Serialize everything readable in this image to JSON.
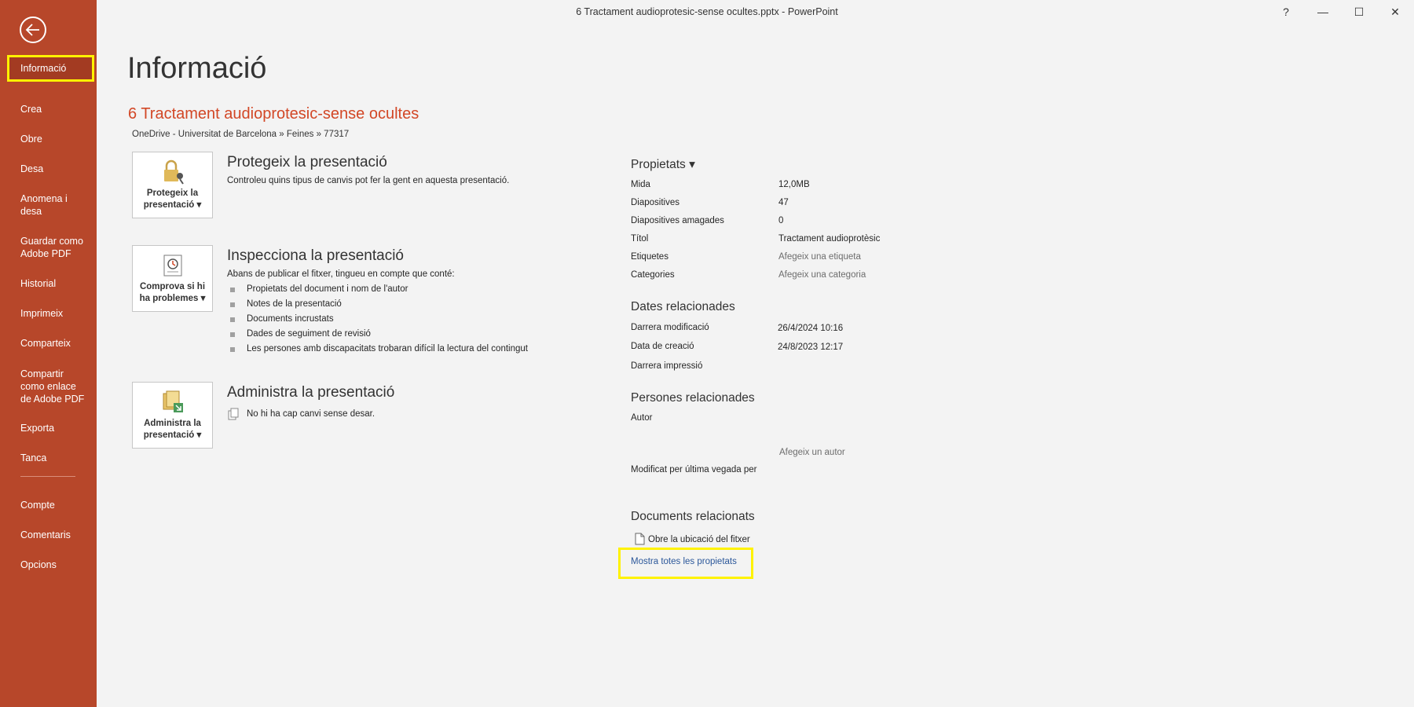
{
  "window": {
    "title": "6 Tractament audioprotesic-sense ocultes.pptx  -  PowerPoint",
    "help": "?",
    "minimize": "—",
    "maximize": "☐",
    "close": "✕"
  },
  "sidebar": {
    "items": [
      "Informació",
      "Crea",
      "Obre",
      "Desa",
      "Anomena i desa",
      "Guardar como Adobe PDF",
      "Historial",
      "Imprimeix",
      "Comparteix",
      "Compartir como enlace de Adobe PDF",
      "Exporta",
      "Tanca",
      "Compte",
      "Comentaris",
      "Opcions"
    ],
    "active": "Informació"
  },
  "main": {
    "page_title": "Informació",
    "doc_title": "6 Tractament audioprotesic-sense ocultes",
    "doc_path": "OneDrive - Universitat de Barcelona » Feines » 77317",
    "protect": {
      "card_label_1": "Protegeix la",
      "card_label_2": "presentació ▾",
      "title": "Protegeix la presentació",
      "desc": "Controleu quins tipus de canvis pot fer la gent en aquesta presentació."
    },
    "inspect": {
      "card_label_1": "Comprova si hi",
      "card_label_2": "ha problemes ▾",
      "title": "Inspecciona la presentació",
      "desc": "Abans de publicar el fitxer, tingueu en compte que conté:",
      "bullets": [
        "Propietats del document i nom de l'autor",
        "Notes de la presentació",
        "Documents incrustats",
        "Dades de seguiment de revisió",
        "Les persones amb discapacitats trobaran difícil la lectura del contingut"
      ]
    },
    "manage": {
      "card_label_1": "Administra la",
      "card_label_2": "presentació ▾",
      "title": "Administra la presentació",
      "desc": "No hi ha cap canvi sense desar."
    }
  },
  "properties": {
    "heading": "Propietats ▾",
    "rows": [
      {
        "label": "Mida",
        "value": "12,0MB"
      },
      {
        "label": "Diapositives",
        "value": "47"
      },
      {
        "label": "Diapositives amagades",
        "value": "0"
      },
      {
        "label": "Títol",
        "value": "Tractament audioprotèsic"
      },
      {
        "label": "Etiquetes",
        "value": "Afegeix una etiqueta"
      },
      {
        "label": "Categories",
        "value": "Afegeix una categoria"
      }
    ],
    "dates_heading": "Dates relacionades",
    "dates": [
      {
        "label": "Darrera modificació",
        "value": "26/4/2024 10:16"
      },
      {
        "label": "Data de creació",
        "value": "24/8/2023 12:17"
      },
      {
        "label": "Darrera impressió",
        "value": ""
      }
    ],
    "people_heading": "Persones relacionades",
    "author_label": "Autor",
    "add_author": "Afegeix un autor",
    "modified_by_label": "Modificat per última vegada per",
    "docs_heading": "Documents relacionats",
    "open_location": "Obre la ubicació del fitxer",
    "show_all": "Mostra totes les propietats"
  },
  "colors": {
    "sidebar": "#b7472a",
    "accent": "#d24726",
    "highlight": "#fff200",
    "link": "#2b579a"
  }
}
